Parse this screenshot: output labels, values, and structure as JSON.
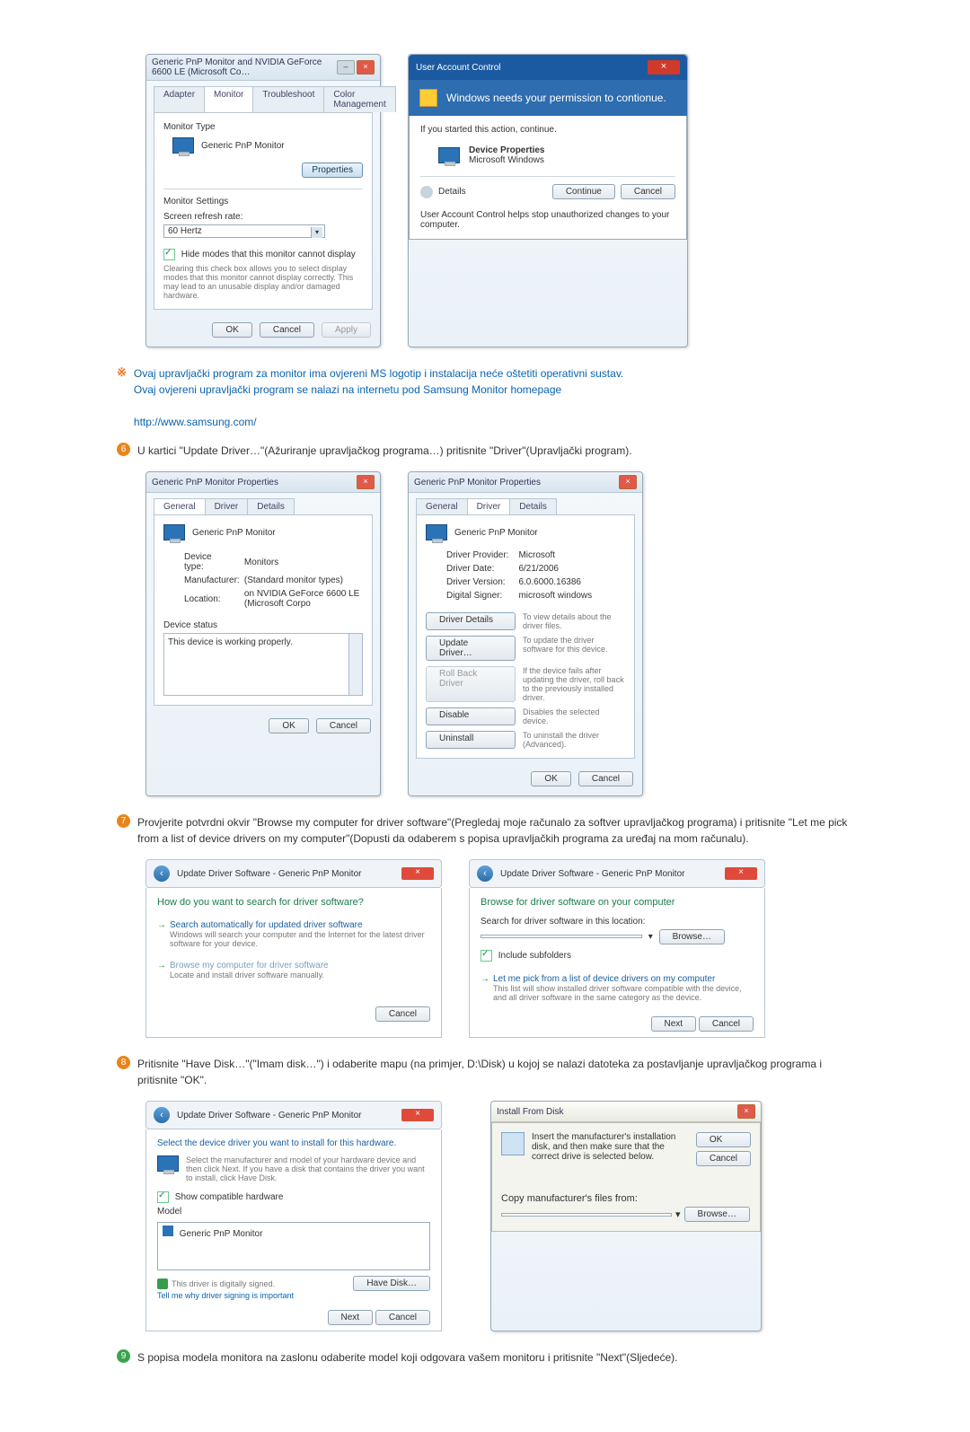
{
  "dialog1": {
    "title": "Generic PnP Monitor and NVIDIA GeForce 6600 LE (Microsoft Co…",
    "tabs": [
      "Adapter",
      "Monitor",
      "Troubleshoot",
      "Color Management"
    ],
    "active_tab": "Monitor",
    "monitor_type_label": "Monitor Type",
    "monitor_type_value": "Generic PnP Monitor",
    "properties_btn": "Properties",
    "monitor_settings_label": "Monitor Settings",
    "refresh_rate_label": "Screen refresh rate:",
    "refresh_rate_value": "60 Hertz",
    "hide_modes_check": "Hide modes that this monitor cannot display",
    "hide_modes_desc": "Clearing this check box allows you to select display modes that this monitor cannot display correctly. This may lead to an unusable display and/or damaged hardware.",
    "ok": "OK",
    "cancel": "Cancel",
    "apply": "Apply"
  },
  "uac": {
    "title": "User Account Control",
    "headline": "Windows needs your permission to contionue.",
    "started_label": "If you started this action, continue.",
    "item_title": "Device Properties",
    "item_sub": "Microsoft Windows",
    "details": "Details",
    "continue": "Continue",
    "cancel": "Cancel",
    "footnote": "User Account Control helps stop unauthorized changes to your computer."
  },
  "note": {
    "line1": "Ovaj upravljački program za monitor ima ovjereni MS logotip i instalacija neće oštetiti operativni sustav.",
    "line2": "Ovaj ovjereni upravljački program se nalazi na internetu pod Samsung Monitor homepage",
    "link": "http://www.samsung.com/"
  },
  "step6": {
    "num": "6",
    "text": "U kartici \"Update Driver…\"(Ažuriranje upravljačkog programa…) pritisnite \"Driver\"(Upravljački program)."
  },
  "props_general": {
    "title": "Generic PnP Monitor Properties",
    "tabs": [
      "General",
      "Driver",
      "Details"
    ],
    "active_tab": "General",
    "name": "Generic PnP Monitor",
    "devtype_label": "Device type:",
    "devtype": "Monitors",
    "mfr_label": "Manufacturer:",
    "mfr": "(Standard monitor types)",
    "loc_label": "Location:",
    "loc": "on NVIDIA GeForce 6600 LE (Microsoft Corpo",
    "status_label": "Device status",
    "status_text": "This device is working properly.",
    "ok": "OK",
    "cancel": "Cancel"
  },
  "props_driver": {
    "title": "Generic PnP Monitor Properties",
    "tabs": [
      "General",
      "Driver",
      "Details"
    ],
    "active_tab": "Driver",
    "name": "Generic PnP Monitor",
    "provider_label": "Driver Provider:",
    "provider": "Microsoft",
    "date_label": "Driver Date:",
    "date": "6/21/2006",
    "version_label": "Driver Version:",
    "version": "6.0.6000.16386",
    "signer_label": "Digital Signer:",
    "signer": "microsoft windows",
    "btn_details": "Driver Details",
    "btn_details_desc": "To view details about the driver files.",
    "btn_update": "Update Driver…",
    "btn_update_desc": "To update the driver software for this device.",
    "btn_rollback": "Roll Back Driver",
    "btn_rollback_desc": "If the device fails after updating the driver, roll back to the previously installed driver.",
    "btn_disable": "Disable",
    "btn_disable_desc": "Disables the selected device.",
    "btn_uninstall": "Uninstall",
    "btn_uninstall_desc": "To uninstall the driver (Advanced).",
    "ok": "OK",
    "cancel": "Cancel"
  },
  "step7": {
    "num": "7",
    "text": "Provjerite potvrdni okvir \"Browse my computer for driver software\"(Pregledaj moje računalo za softver upravljačkog programa) i pritisnite \"Let me pick from a list of device drivers on my computer\"(Dopusti da odaberem s popisa upravljačkih programa za uređaj na mom računalu)."
  },
  "search_dlg": {
    "crumb": "Update Driver Software - Generic PnP Monitor",
    "heading": "How do you want to search for driver software?",
    "opt1_title": "Search automatically for updated driver software",
    "opt1_desc": "Windows will search your computer and the Internet for the latest driver software for your device.",
    "opt2_title": "Browse my computer for driver software",
    "opt2_desc": "Locate and install driver software manually.",
    "cancel": "Cancel"
  },
  "browse_dlg": {
    "crumb": "Update Driver Software - Generic PnP Monitor",
    "heading": "Browse for driver software on your computer",
    "search_label": "Search for driver software in this location:",
    "path": " ",
    "browse": "Browse…",
    "include_sub": "Include subfolders",
    "letme": "Let me pick from a list of device drivers on my computer",
    "letme_desc": "This list will show installed driver software compatible with the device, and all driver software in the same category as the device.",
    "next": "Next",
    "cancel": "Cancel"
  },
  "step8": {
    "num": "8",
    "text": "Pritisnite \"Have Disk…\"(\"Imam disk…\") i odaberite mapu (na primjer, D:\\Disk) u kojoj se nalazi datoteka za postavljanje upravljačkog programa i pritisnite \"OK\"."
  },
  "select_dlg": {
    "crumb": "Update Driver Software - Generic PnP Monitor",
    "heading": "Select the device driver you want to install for this hardware.",
    "instr": "Select the manufacturer and model of your hardware device and then click Next. If you have a disk that contains the driver you want to install, click Have Disk.",
    "show_compat": "Show compatible hardware",
    "model_label": "Model",
    "model_item": "Generic PnP Monitor",
    "signed_note": "This driver is digitally signed.",
    "tell_me": "Tell me why driver signing is important",
    "have_disk": "Have Disk…",
    "next": "Next",
    "cancel": "Cancel"
  },
  "ifd": {
    "title": "Install From Disk",
    "instr": "Insert the manufacturer's installation disk, and then make sure that the correct drive is selected below.",
    "ok": "OK",
    "cancel": "Cancel",
    "copy_label": "Copy manufacturer's files from:",
    "path": " ",
    "browse": "Browse…"
  },
  "step9": {
    "num": "9",
    "text": "S popisa modela monitora na zaslonu odaberite model koji odgovara vašem monitoru i pritisnite \"Next\"(Sljedeće)."
  }
}
